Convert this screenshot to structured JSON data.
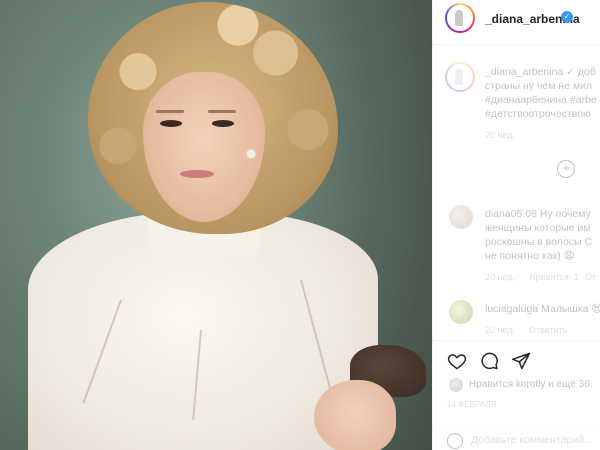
{
  "post": {
    "author": "_diana_arbenina",
    "verified_mark": "✓"
  },
  "caption": {
    "author": "_diana_arbenina",
    "lines": [
      "_diana_arbenina ✓ доб",
      "страны ну чем не мил",
      "#дианаарбенина #arbe",
      "#детствоотрочествою"
    ],
    "time": "20 нед."
  },
  "comments": [
    {
      "author": "diana05.08",
      "lines": [
        "diana05.08 Ну почему",
        "женщины которые им",
        "роскошны в волосы С",
        "не понятно как) 😩"
      ],
      "meta": [
        "20 нед.",
        "Нравится: 1",
        "От"
      ]
    },
    {
      "author": "luciagaluga",
      "lines": [
        "luciagaluga Малышка 😍"
      ],
      "meta": [
        "20 нед.",
        "Ответить"
      ]
    }
  ],
  "actions": {
    "like_icon": "heart-icon",
    "comment_icon": "comment-icon",
    "share_icon": "share-icon"
  },
  "likes_text": "Нравится korotly и ещё 36",
  "date_text": "14 ФЕВРАЛЯ",
  "add_comment_placeholder": "Добавьте комментарий..."
}
